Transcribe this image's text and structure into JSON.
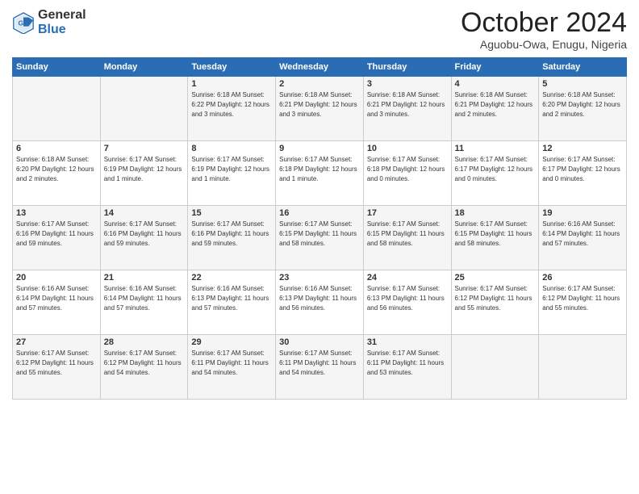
{
  "header": {
    "logo_general": "General",
    "logo_blue": "Blue",
    "month_title": "October 2024",
    "location": "Aguobu-Owa, Enugu, Nigeria"
  },
  "days_of_week": [
    "Sunday",
    "Monday",
    "Tuesday",
    "Wednesday",
    "Thursday",
    "Friday",
    "Saturday"
  ],
  "weeks": [
    [
      {
        "day": "",
        "info": ""
      },
      {
        "day": "",
        "info": ""
      },
      {
        "day": "1",
        "info": "Sunrise: 6:18 AM\nSunset: 6:22 PM\nDaylight: 12 hours and 3 minutes."
      },
      {
        "day": "2",
        "info": "Sunrise: 6:18 AM\nSunset: 6:21 PM\nDaylight: 12 hours and 3 minutes."
      },
      {
        "day": "3",
        "info": "Sunrise: 6:18 AM\nSunset: 6:21 PM\nDaylight: 12 hours and 3 minutes."
      },
      {
        "day": "4",
        "info": "Sunrise: 6:18 AM\nSunset: 6:21 PM\nDaylight: 12 hours and 2 minutes."
      },
      {
        "day": "5",
        "info": "Sunrise: 6:18 AM\nSunset: 6:20 PM\nDaylight: 12 hours and 2 minutes."
      }
    ],
    [
      {
        "day": "6",
        "info": "Sunrise: 6:18 AM\nSunset: 6:20 PM\nDaylight: 12 hours and 2 minutes."
      },
      {
        "day": "7",
        "info": "Sunrise: 6:17 AM\nSunset: 6:19 PM\nDaylight: 12 hours and 1 minute."
      },
      {
        "day": "8",
        "info": "Sunrise: 6:17 AM\nSunset: 6:19 PM\nDaylight: 12 hours and 1 minute."
      },
      {
        "day": "9",
        "info": "Sunrise: 6:17 AM\nSunset: 6:18 PM\nDaylight: 12 hours and 1 minute."
      },
      {
        "day": "10",
        "info": "Sunrise: 6:17 AM\nSunset: 6:18 PM\nDaylight: 12 hours and 0 minutes."
      },
      {
        "day": "11",
        "info": "Sunrise: 6:17 AM\nSunset: 6:17 PM\nDaylight: 12 hours and 0 minutes."
      },
      {
        "day": "12",
        "info": "Sunrise: 6:17 AM\nSunset: 6:17 PM\nDaylight: 12 hours and 0 minutes."
      }
    ],
    [
      {
        "day": "13",
        "info": "Sunrise: 6:17 AM\nSunset: 6:16 PM\nDaylight: 11 hours and 59 minutes."
      },
      {
        "day": "14",
        "info": "Sunrise: 6:17 AM\nSunset: 6:16 PM\nDaylight: 11 hours and 59 minutes."
      },
      {
        "day": "15",
        "info": "Sunrise: 6:17 AM\nSunset: 6:16 PM\nDaylight: 11 hours and 59 minutes."
      },
      {
        "day": "16",
        "info": "Sunrise: 6:17 AM\nSunset: 6:15 PM\nDaylight: 11 hours and 58 minutes."
      },
      {
        "day": "17",
        "info": "Sunrise: 6:17 AM\nSunset: 6:15 PM\nDaylight: 11 hours and 58 minutes."
      },
      {
        "day": "18",
        "info": "Sunrise: 6:17 AM\nSunset: 6:15 PM\nDaylight: 11 hours and 58 minutes."
      },
      {
        "day": "19",
        "info": "Sunrise: 6:16 AM\nSunset: 6:14 PM\nDaylight: 11 hours and 57 minutes."
      }
    ],
    [
      {
        "day": "20",
        "info": "Sunrise: 6:16 AM\nSunset: 6:14 PM\nDaylight: 11 hours and 57 minutes."
      },
      {
        "day": "21",
        "info": "Sunrise: 6:16 AM\nSunset: 6:14 PM\nDaylight: 11 hours and 57 minutes."
      },
      {
        "day": "22",
        "info": "Sunrise: 6:16 AM\nSunset: 6:13 PM\nDaylight: 11 hours and 57 minutes."
      },
      {
        "day": "23",
        "info": "Sunrise: 6:16 AM\nSunset: 6:13 PM\nDaylight: 11 hours and 56 minutes."
      },
      {
        "day": "24",
        "info": "Sunrise: 6:17 AM\nSunset: 6:13 PM\nDaylight: 11 hours and 56 minutes."
      },
      {
        "day": "25",
        "info": "Sunrise: 6:17 AM\nSunset: 6:12 PM\nDaylight: 11 hours and 55 minutes."
      },
      {
        "day": "26",
        "info": "Sunrise: 6:17 AM\nSunset: 6:12 PM\nDaylight: 11 hours and 55 minutes."
      }
    ],
    [
      {
        "day": "27",
        "info": "Sunrise: 6:17 AM\nSunset: 6:12 PM\nDaylight: 11 hours and 55 minutes."
      },
      {
        "day": "28",
        "info": "Sunrise: 6:17 AM\nSunset: 6:12 PM\nDaylight: 11 hours and 54 minutes."
      },
      {
        "day": "29",
        "info": "Sunrise: 6:17 AM\nSunset: 6:11 PM\nDaylight: 11 hours and 54 minutes."
      },
      {
        "day": "30",
        "info": "Sunrise: 6:17 AM\nSunset: 6:11 PM\nDaylight: 11 hours and 54 minutes."
      },
      {
        "day": "31",
        "info": "Sunrise: 6:17 AM\nSunset: 6:11 PM\nDaylight: 11 hours and 53 minutes."
      },
      {
        "day": "",
        "info": ""
      },
      {
        "day": "",
        "info": ""
      }
    ]
  ]
}
